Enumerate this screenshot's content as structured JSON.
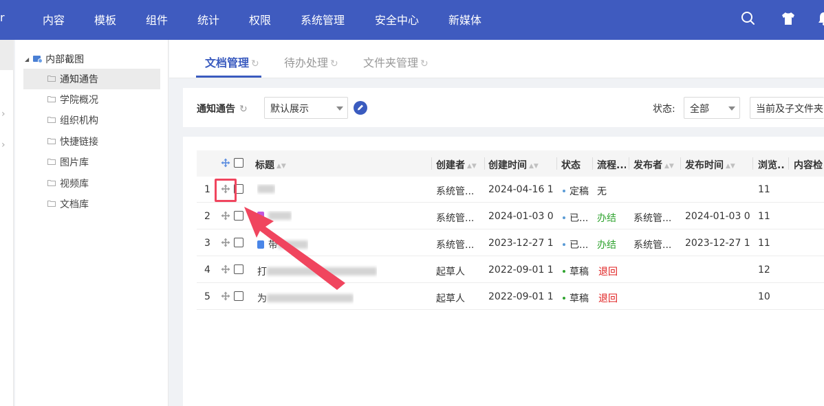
{
  "topnav": {
    "edge_text": "r",
    "items": [
      "内容",
      "模板",
      "组件",
      "统计",
      "权限",
      "系统管理",
      "安全中心",
      "新媒体"
    ]
  },
  "tree": {
    "root": "内部截图",
    "items": [
      {
        "label": "通知通告",
        "active": true
      },
      {
        "label": "学院概况"
      },
      {
        "label": "组织机构"
      },
      {
        "label": "快捷链接"
      },
      {
        "label": "图片库"
      },
      {
        "label": "视频库"
      },
      {
        "label": "文档库"
      }
    ]
  },
  "tabs": [
    {
      "label": "文档管理",
      "active": true
    },
    {
      "label": "待办处理"
    },
    {
      "label": "文件夹管理"
    }
  ],
  "filter": {
    "title": "通知通告",
    "view_select": "默认展示",
    "status_label": "状态:",
    "status_select": "全部",
    "scope_select": "当前及子文件夹"
  },
  "table": {
    "headers": {
      "title": "标题",
      "creator": "创建者",
      "created_at": "创建时间",
      "status": "状态",
      "flow": "流程...",
      "publisher": "发布者",
      "published_at": "发布时间",
      "views": "浏览...",
      "content_check": "内容检"
    },
    "rows": [
      {
        "num": "1",
        "creator": "系统管...",
        "created_at": "2024-04-16 1...",
        "status": "定稿",
        "flow": "无",
        "publisher": "",
        "published_at": "",
        "views": "11"
      },
      {
        "num": "2",
        "creator": "系统管...",
        "created_at": "2024-01-03 0...",
        "status": "已...",
        "flow": "办结",
        "publisher": "系统管...",
        "published_at": "2024-01-03 0...",
        "views": "11"
      },
      {
        "num": "3",
        "title_prefix": "带",
        "creator": "系统管...",
        "created_at": "2023-12-27 1...",
        "status": "已...",
        "flow": "办结",
        "publisher": "系统管...",
        "published_at": "2023-12-27 1...",
        "views": "11"
      },
      {
        "num": "4",
        "title_prefix": "打",
        "creator": "起草人",
        "created_at": "2022-09-01 1...",
        "status": "草稿",
        "flow": "退回",
        "publisher": "",
        "published_at": "",
        "views": "12"
      },
      {
        "num": "5",
        "title_prefix": "为",
        "creator": "起草人",
        "created_at": "2022-09-01 1...",
        "status": "草稿",
        "flow": "退回",
        "publisher": "",
        "published_at": "",
        "views": "10"
      }
    ]
  },
  "colors": {
    "brand": "#3f5bbf",
    "status_dot_final": "#5b9bd5",
    "status_dot_draft": "#2fa32f",
    "flow_done": "#2fa32f",
    "flow_returned": "#e02020",
    "annotation": "#f0455e"
  }
}
